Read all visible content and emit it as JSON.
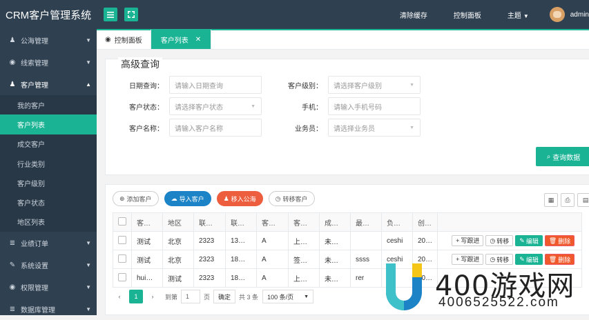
{
  "app": {
    "title": "CRM客户管理系统"
  },
  "topbar": {
    "clear_cache": "清除缓存",
    "dashboard": "控制面板",
    "theme": "主题",
    "user": "admin"
  },
  "sidebar": {
    "items": [
      {
        "label": "公海管理",
        "icon": "user-icon"
      },
      {
        "label": "线索管理",
        "icon": "globe-icon"
      },
      {
        "label": "客户管理",
        "icon": "user-icon",
        "expanded": true,
        "sub": [
          {
            "label": "我的客户"
          },
          {
            "label": "客户列表",
            "active": true
          },
          {
            "label": "成交客户"
          },
          {
            "label": "行业类别"
          },
          {
            "label": "客户级别"
          },
          {
            "label": "客户状态"
          },
          {
            "label": "地区列表"
          }
        ]
      },
      {
        "label": "业绩订单",
        "icon": "database-icon"
      },
      {
        "label": "系统设置",
        "icon": "wrench-icon"
      },
      {
        "label": "权限管理",
        "icon": "globe-icon"
      },
      {
        "label": "数据库管理",
        "icon": "database-icon"
      }
    ]
  },
  "tabs": [
    {
      "label": "控制面板"
    },
    {
      "label": "客户列表",
      "active": true
    }
  ],
  "search": {
    "legend": "高级查询",
    "fields": [
      {
        "label": "日期查询：",
        "placeholder": "请输入日期查询"
      },
      {
        "label": "客户级别：",
        "placeholder": "请选择客户级别",
        "select": true
      },
      {
        "label": "客户状态：",
        "placeholder": "请选择客户状态",
        "select": true
      },
      {
        "label": "手机：",
        "placeholder": "请输入手机号码"
      },
      {
        "label": "客户名称：",
        "placeholder": "请输入客户名称"
      },
      {
        "label": "业务员：",
        "placeholder": "请选择业务员",
        "select": true
      }
    ],
    "button": "查询数据"
  },
  "toolbar": {
    "add": "添加客户",
    "import": "导入客户",
    "move": "移入公海",
    "transfer": "转移客户"
  },
  "table": {
    "headers": [
      "客…",
      "地区",
      "联…",
      "联…",
      "客…",
      "客…",
      "成…",
      "最…",
      "负…",
      "创…"
    ],
    "rows": [
      [
        "测试",
        "北京",
        "2323",
        "13…",
        "A",
        "上…",
        "未…",
        "",
        "ceshi",
        "20…"
      ],
      [
        "测试",
        "北京",
        "2323",
        "18…",
        "A",
        "签…",
        "未…",
        "ssss",
        "ceshi",
        "20…"
      ],
      [
        "hui…",
        "测试",
        "2323",
        "18…",
        "A",
        "上…",
        "未…",
        "rer",
        "",
        "20…"
      ]
    ],
    "ops": {
      "follow": "写跟进",
      "transfer": "转移",
      "edit": "编辑",
      "delete": "删除"
    }
  },
  "pager": {
    "current": "1",
    "goto": "到第",
    "page_input": "1",
    "page_unit": "页",
    "confirm": "确定",
    "total": "共 3 条",
    "page_size": "100 条/页"
  },
  "watermark": {
    "text": "400游戏网",
    "number": "4006525522.com"
  },
  "colors": {
    "sidebar": "#2f4050",
    "accent": "#1ab394",
    "blue": "#1c84c6",
    "orange": "#f0592c"
  }
}
